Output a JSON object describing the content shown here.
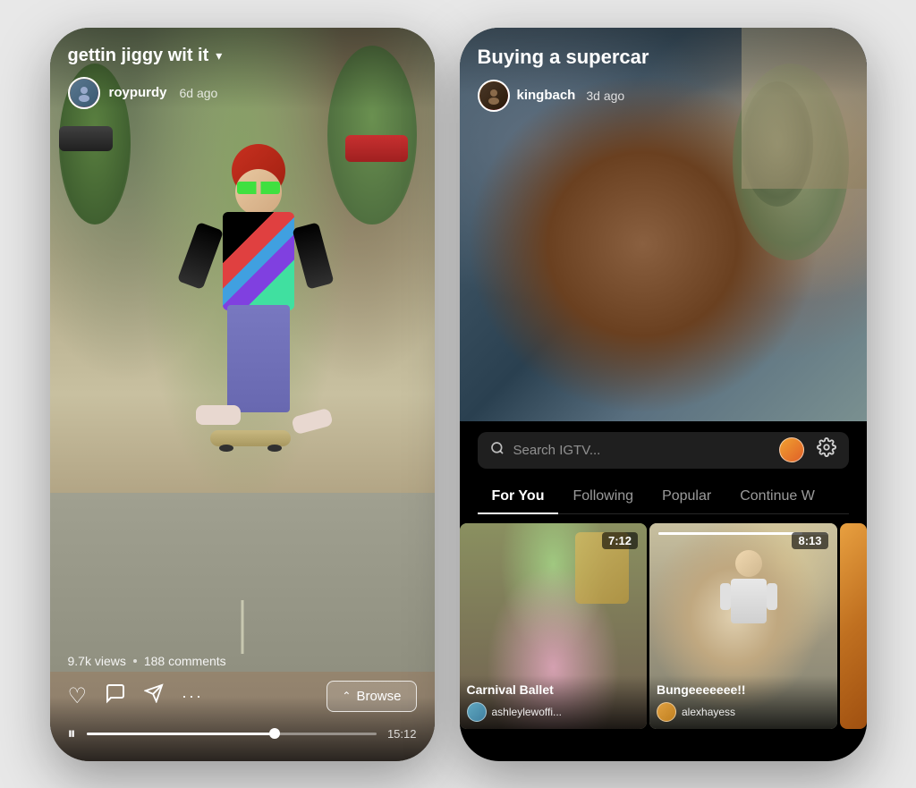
{
  "left_phone": {
    "title": "gettin jiggy wit it",
    "title_dropdown": "▾",
    "user": {
      "name": "roypurdy",
      "time_ago": "6d ago"
    },
    "stats": {
      "views": "9.7k views",
      "dot": "•",
      "comments": "188 comments"
    },
    "actions": {
      "like_icon": "♡",
      "comment_icon": "💬",
      "share_icon": "▷",
      "more_icon": "•••"
    },
    "browse_btn": {
      "arrow": "⌃",
      "label": "Browse"
    },
    "player": {
      "play_icon": "⏸",
      "time": "15:12"
    }
  },
  "right_phone": {
    "title": "Buying a supercar",
    "user": {
      "name": "kingbach",
      "time_ago": "3d ago"
    },
    "search": {
      "placeholder": "Search IGTV...",
      "search_icon": "🔍"
    },
    "tabs": [
      {
        "label": "For You",
        "active": true
      },
      {
        "label": "Following",
        "active": false
      },
      {
        "label": "Popular",
        "active": false
      },
      {
        "label": "Continue W",
        "active": false
      }
    ],
    "thumbnails": [
      {
        "id": "ballet",
        "title": "Carnival Ballet",
        "username": "ashleylewoffi...",
        "duration": "7:12"
      },
      {
        "id": "bungee",
        "title": "Bungeeeeeee!!",
        "username": "alexhayess",
        "duration": "8:13"
      },
      {
        "id": "third",
        "title": "",
        "username": "",
        "duration": ""
      }
    ]
  }
}
